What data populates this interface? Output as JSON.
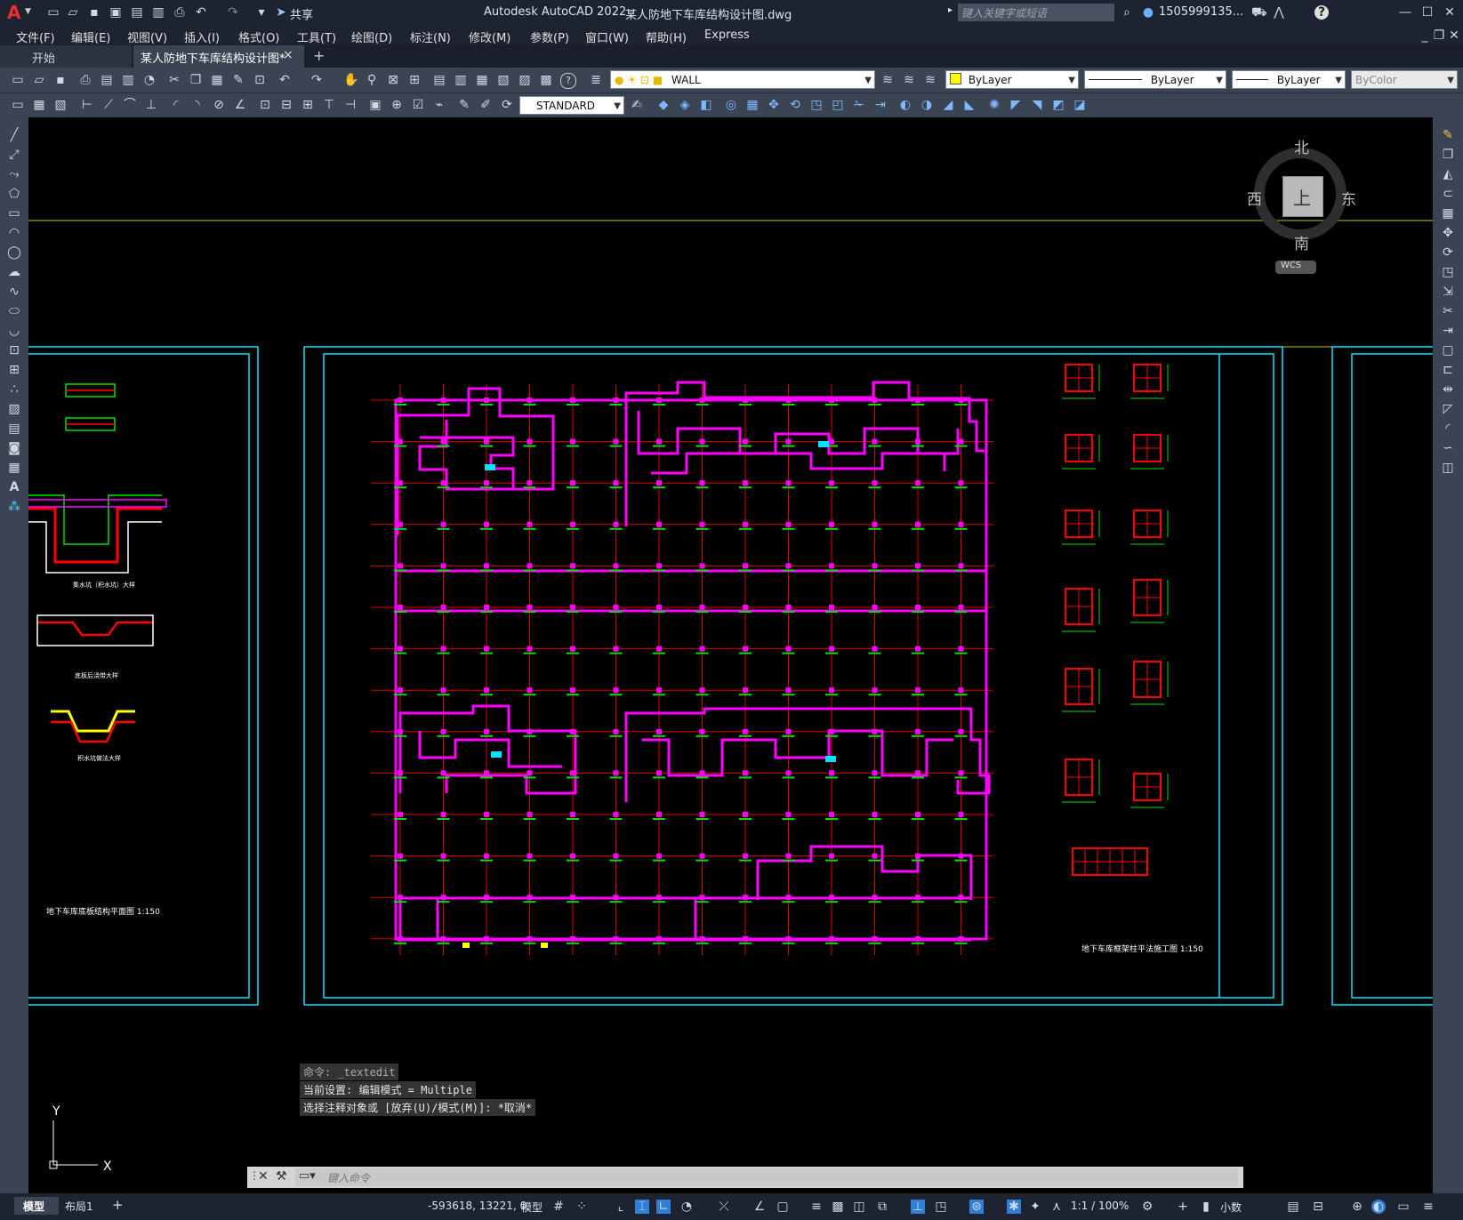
{
  "app": {
    "title": "Autodesk AutoCAD 2022",
    "document": "某人防地下车库结构设计图.dwg",
    "logo": "A",
    "share": "共享",
    "search_placeholder": "键入关键字或短语",
    "user": "1505999135...",
    "help": "?"
  },
  "menu": [
    "文件(F)",
    "编辑(E)",
    "视图(V)",
    "插入(I)",
    "格式(O)",
    "工具(T)",
    "绘图(D)",
    "标注(N)",
    "修改(M)",
    "参数(P)",
    "窗口(W)",
    "帮助(H)",
    "Express"
  ],
  "tabs": {
    "start": "开始",
    "active": "某人防地下车库结构设计图*",
    "close": "×",
    "add": "+"
  },
  "toolbar": {
    "layer": "WALL",
    "color": "ByLayer",
    "linetype": "ByLayer",
    "lineweight": "ByLayer",
    "plotstyle": "ByColor",
    "textstyle": "STANDARD"
  },
  "viewcube": {
    "north": "北",
    "south": "南",
    "east": "东",
    "west": "西",
    "top": "上",
    "wcs": "WCS"
  },
  "drawing": {
    "ucs_x": "X",
    "ucs_y": "Y",
    "left_title": "地下车库底板结构平面图 1:150",
    "right_title": "地下车库框架柱平法施工图 1:150",
    "detail1": "集水坑（积水坑）大样",
    "detail2": "底板后浇带大样",
    "detail3": "积水坑做法大样"
  },
  "command": {
    "history": [
      "命令: _textedit",
      "当前设置: 编辑模式 = Multiple",
      "选择注释对象或 [放弃(U)/模式(M)]: *取消*"
    ],
    "placeholder": "键入命令"
  },
  "status": {
    "model_tab": "模型",
    "layout_tab": "布局1",
    "add": "+",
    "coords": "-593618, 13221, 0",
    "space": "模型",
    "scale": "1:1 / 100%",
    "units": "小数"
  },
  "colors": {
    "magenta": "#ff00ff",
    "cyan": "#00e5ff",
    "red": "#e00000",
    "green": "#00e000",
    "yellow": "#ffff00",
    "olive": "#c8c800"
  }
}
